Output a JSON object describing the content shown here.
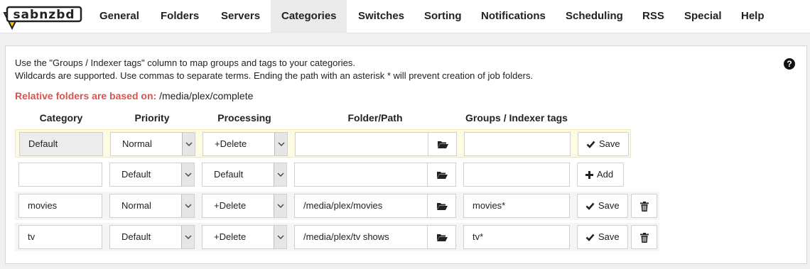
{
  "app": {
    "logo_text": "sabnzbd"
  },
  "nav": {
    "items": [
      {
        "label": "General"
      },
      {
        "label": "Folders"
      },
      {
        "label": "Servers"
      },
      {
        "label": "Categories",
        "active": true
      },
      {
        "label": "Switches"
      },
      {
        "label": "Sorting"
      },
      {
        "label": "Notifications"
      },
      {
        "label": "Scheduling"
      },
      {
        "label": "RSS"
      },
      {
        "label": "Special"
      },
      {
        "label": "Help"
      }
    ]
  },
  "help": {
    "line1": "Use the \"Groups / Indexer tags\" column to map groups and tags to your categories.",
    "line2": "Wildcards are supported. Use commas to separate terms. Ending the path with an asterisk * will prevent creation of job folders.",
    "relative_label": "Relative folders are based on:",
    "relative_path": " /media/plex/complete"
  },
  "columns": {
    "category": "Category",
    "priority": "Priority",
    "processing": "Processing",
    "folder": "Folder/Path",
    "groups": "Groups / Indexer tags"
  },
  "rows": [
    {
      "category": "Default",
      "priority": "Normal",
      "processing": "+Delete",
      "folder": "",
      "groups": "",
      "action": "Save"
    },
    {
      "category": "",
      "priority": "Default",
      "processing": "Default",
      "folder": "",
      "groups": "",
      "action": "Add"
    },
    {
      "category": "movies",
      "priority": "Normal",
      "processing": "+Delete",
      "folder": "/media/plex/movies",
      "groups": "movies*",
      "action": "Save"
    },
    {
      "category": "tv",
      "priority": "Default",
      "processing": "+Delete",
      "folder": "/media/plex/tv shows",
      "groups": "tv*",
      "action": "Save"
    }
  ],
  "colors": {
    "accent_red": "#d9534f",
    "highlight_row": "#fdfbe3",
    "logo_yellow": "#f2c516"
  }
}
